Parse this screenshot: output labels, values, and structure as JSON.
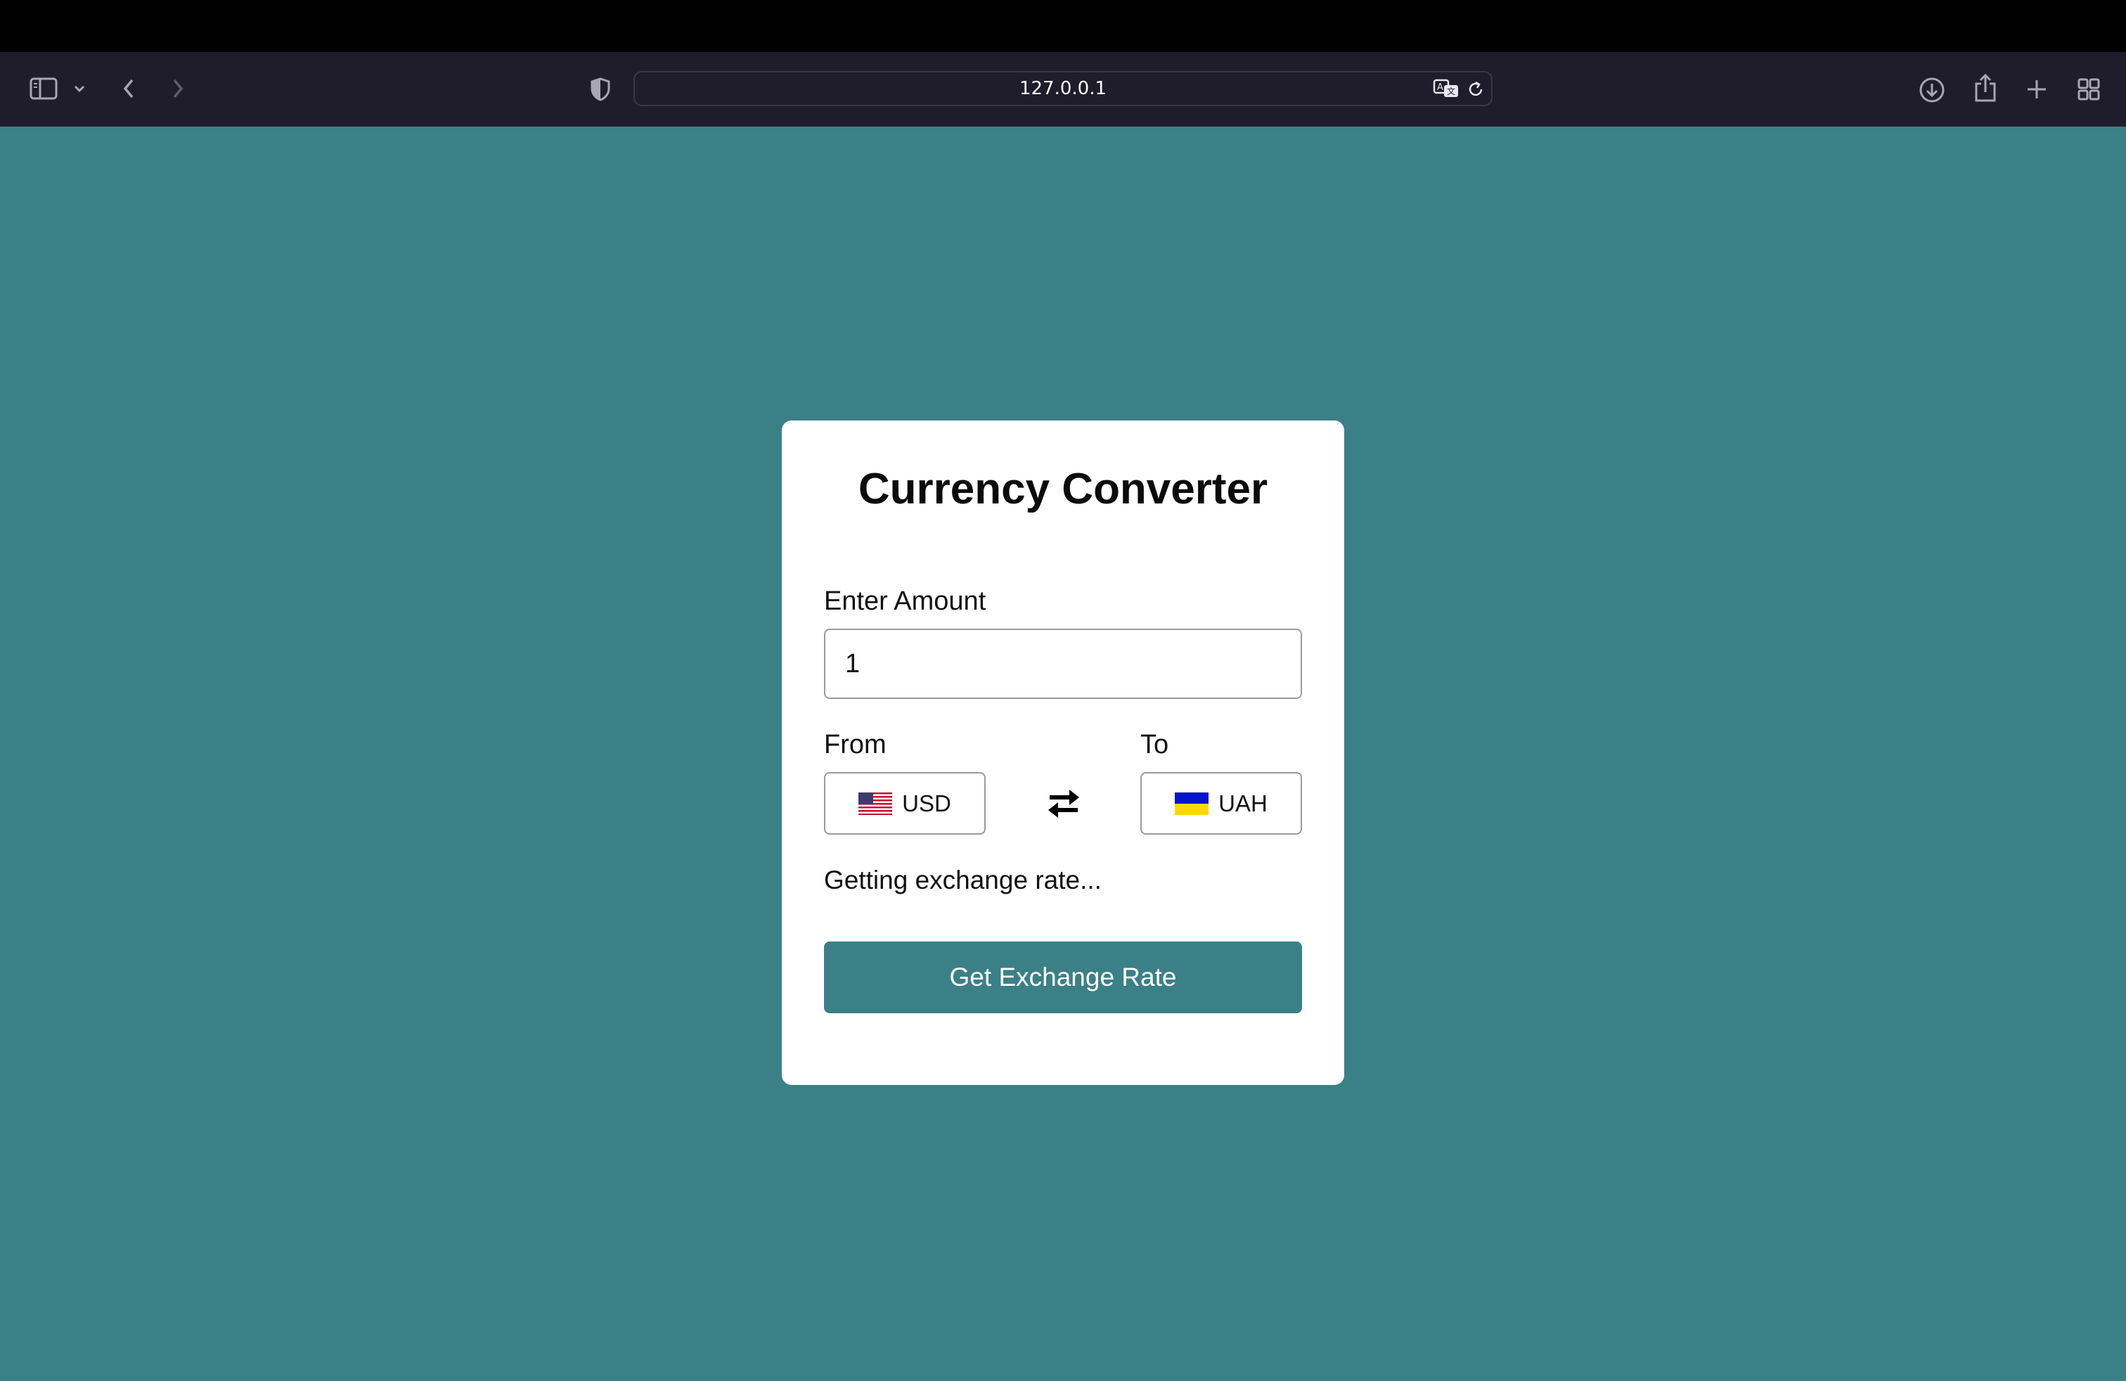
{
  "browser": {
    "url": "127.0.0.1",
    "icons": {
      "sidebar": "sidebar-icon",
      "sidebar_menu": "chevron-down-icon",
      "back": "back-arrow-icon",
      "forward": "forward-arrow-icon",
      "privacy": "shield-icon",
      "translate": "translate-icon",
      "reload": "reload-icon",
      "downloads": "download-icon",
      "share": "share-icon",
      "new_tab": "plus-icon",
      "tab_overview": "tab-grid-icon"
    }
  },
  "converter": {
    "title": "Currency Converter",
    "amount_label": "Enter Amount",
    "amount_value": "1",
    "from_label": "From",
    "to_label": "To",
    "from_currency": "USD",
    "to_currency": "UAH",
    "swap_icon": "swap-arrows-icon",
    "status": "Getting exchange rate...",
    "button_label": "Get Exchange Rate"
  },
  "colors": {
    "page_background": "#3b8087",
    "button_background": "#3b8087",
    "toolbar": "#1f1d2b"
  }
}
